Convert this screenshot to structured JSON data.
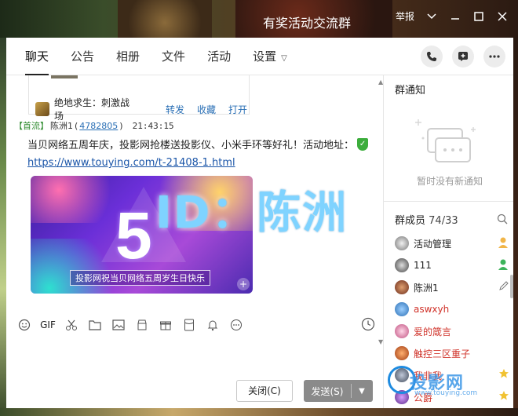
{
  "window": {
    "title": "有奖活动交流群",
    "report_label": "举报",
    "icons": [
      "chevron-down-icon",
      "minimize-icon",
      "maximize-icon",
      "close-icon"
    ]
  },
  "tabs": [
    {
      "label": "聊天",
      "active": true
    },
    {
      "label": "公告"
    },
    {
      "label": "相册"
    },
    {
      "label": "文件"
    },
    {
      "label": "活动"
    },
    {
      "label": "设置"
    }
  ],
  "top_actions": [
    "phone-icon",
    "add-app-icon",
    "more-icon"
  ],
  "chat": {
    "share_card": {
      "game_name": "绝地求生：刺激战场",
      "actions": [
        "转发",
        "收藏",
        "打开"
      ]
    },
    "message": {
      "tag": "【首流】",
      "sender": "陈洲1",
      "qq": "4782805",
      "time": "21:43:15",
      "text": "当贝网络五周年庆，投影网抢楼送投影仪、小米手环等好礼！活动地址：",
      "link": "https://www.touying.com/t-21408-1.html",
      "banner_number": "5",
      "banner_caption": "投影网祝当贝网络五周岁生日快乐"
    },
    "overlay_text": "ID：陈洲"
  },
  "toolbar": {
    "gif_label": "GIF"
  },
  "buttons": {
    "close": "关闭(C)",
    "send": "发送(S)"
  },
  "sidebar": {
    "notice_title": "群通知",
    "empty_notice": "暂时没有新通知",
    "members_title": "群成员",
    "members_count": "74/33",
    "members": [
      {
        "name": "活动管理",
        "style": "normal",
        "badge": "owner"
      },
      {
        "name": "111",
        "style": "normal",
        "badge": "admin"
      },
      {
        "name": "陈洲1",
        "style": "normal",
        "badge": "edit"
      },
      {
        "name": "aswxyh",
        "style": "red",
        "badge": ""
      },
      {
        "name": "爱的箴言",
        "style": "red",
        "badge": ""
      },
      {
        "name": "触控三区重子",
        "style": "red",
        "badge": ""
      },
      {
        "name": "我非我",
        "style": "red",
        "badge": "star"
      },
      {
        "name": "公爵",
        "style": "red",
        "badge": "star"
      }
    ]
  },
  "watermark": {
    "text": "投影网",
    "sub": "www.touying.com"
  }
}
